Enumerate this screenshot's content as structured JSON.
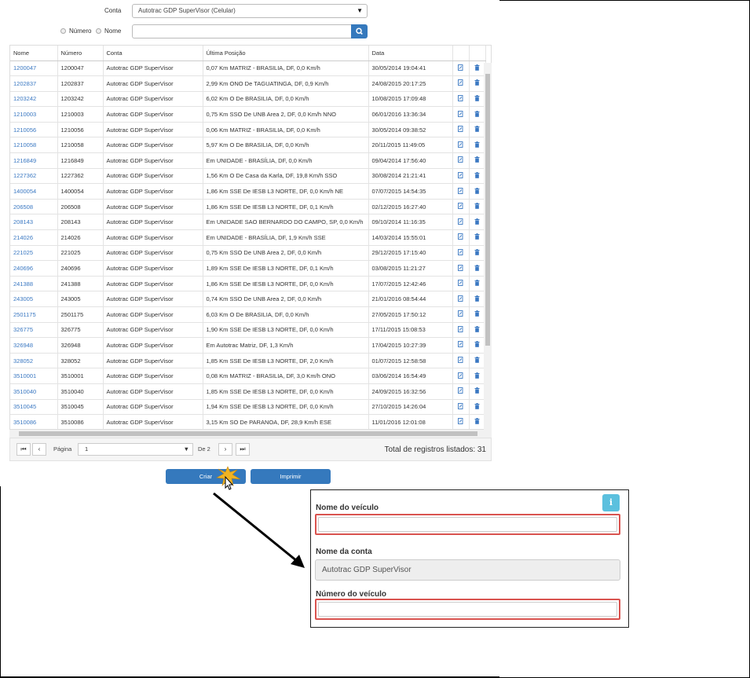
{
  "filters": {
    "account_label": "Conta",
    "account_value": "Autotrac GDP SuperVisor (Celular)",
    "radio_numero": "Número",
    "radio_nome": "Nome",
    "search_value": ""
  },
  "table": {
    "headers": [
      "Nome",
      "Número",
      "Conta",
      "Última Posição",
      "Data"
    ],
    "rows": [
      [
        "1200047",
        "1200047",
        "Autotrac GDP SuperVisor",
        "0,07 Km MATRIZ - BRASILIA, DF, 0,0 Km/h",
        "30/05/2014 19:04:41"
      ],
      [
        "1202837",
        "1202837",
        "Autotrac GDP SuperVisor",
        "2,99 Km ONO De TAGUATINGA, DF, 0,9 Km/h",
        "24/08/2015 20:17:25"
      ],
      [
        "1203242",
        "1203242",
        "Autotrac GDP SuperVisor",
        "6,02 Km O De BRASILIA, DF, 0,0 Km/h",
        "10/08/2015 17:09:48"
      ],
      [
        "1210003",
        "1210003",
        "Autotrac GDP SuperVisor",
        "0,75 Km SSO De UNB Area 2, DF, 0,0 Km/h NNO",
        "06/01/2016 13:36:34"
      ],
      [
        "1210056",
        "1210056",
        "Autotrac GDP SuperVisor",
        "0,06 Km MATRIZ - BRASILIA, DF, 0,0 Km/h",
        "30/05/2014 09:38:52"
      ],
      [
        "1210058",
        "1210058",
        "Autotrac GDP SuperVisor",
        "5,97 Km O De BRASILIA, DF, 0,0 Km/h",
        "20/11/2015 11:49:05"
      ],
      [
        "1216849",
        "1216849",
        "Autotrac GDP SuperVisor",
        "Em UNIDADE - BRASÍLIA, DF, 0,0 Km/h",
        "09/04/2014 17:56:40"
      ],
      [
        "1227362",
        "1227362",
        "Autotrac GDP SuperVisor",
        "1,56 Km O De Casa da Karla, DF, 19,8 Km/h SSO",
        "30/08/2014 21:21:41"
      ],
      [
        "1400054",
        "1400054",
        "Autotrac GDP SuperVisor",
        "1,86 Km SSE De IESB L3 NORTE, DF, 0,0 Km/h NE",
        "07/07/2015 14:54:35"
      ],
      [
        "206508",
        "206508",
        "Autotrac GDP SuperVisor",
        "1,86 Km SSE De IESB L3 NORTE, DF, 0,1 Km/h",
        "02/12/2015 16:27:40"
      ],
      [
        "208143",
        "208143",
        "Autotrac GDP SuperVisor",
        "Em UNIDADE SAO BERNARDO DO CAMPO, SP, 0,0 Km/h",
        "09/10/2014 11:16:35"
      ],
      [
        "214026",
        "214026",
        "Autotrac GDP SuperVisor",
        "Em UNIDADE - BRASÍLIA, DF, 1,9 Km/h SSE",
        "14/03/2014 15:55:01"
      ],
      [
        "221025",
        "221025",
        "Autotrac GDP SuperVisor",
        "0,75 Km SSO De UNB Area 2, DF, 0,0 Km/h",
        "29/12/2015 17:15:40"
      ],
      [
        "240696",
        "240696",
        "Autotrac GDP SuperVisor",
        "1,89 Km SSE De IESB L3 NORTE, DF, 0,1 Km/h",
        "03/08/2015 11:21:27"
      ],
      [
        "241388",
        "241388",
        "Autotrac GDP SuperVisor",
        "1,86 Km SSE De IESB L3 NORTE, DF, 0,0 Km/h",
        "17/07/2015 12:42:46"
      ],
      [
        "243005",
        "243005",
        "Autotrac GDP SuperVisor",
        "0,74 Km SSO De UNB Area 2, DF, 0,0 Km/h",
        "21/01/2016 08:54:44"
      ],
      [
        "2501175",
        "2501175",
        "Autotrac GDP SuperVisor",
        "6,03 Km O De BRASILIA, DF, 0,0 Km/h",
        "27/05/2015 17:50:12"
      ],
      [
        "326775",
        "326775",
        "Autotrac GDP SuperVisor",
        "1,90 Km SSE De IESB L3 NORTE, DF, 0,0 Km/h",
        "17/11/2015 15:08:53"
      ],
      [
        "326948",
        "326948",
        "Autotrac GDP SuperVisor",
        "Em Autotrac Matriz, DF, 1,3 Km/h",
        "17/04/2015 10:27:39"
      ],
      [
        "328052",
        "328052",
        "Autotrac GDP SuperVisor",
        "1,85 Km SSE De IESB L3 NORTE, DF, 2,0 Km/h",
        "01/07/2015 12:58:58"
      ],
      [
        "3510001",
        "3510001",
        "Autotrac GDP SuperVisor",
        "0,08 Km MATRIZ - BRASILIA, DF, 3,0 Km/h ONO",
        "03/06/2014 16:54:49"
      ],
      [
        "3510040",
        "3510040",
        "Autotrac GDP SuperVisor",
        "1,85 Km SSE De IESB L3 NORTE, DF, 0,0 Km/h",
        "24/09/2015 16:32:56"
      ],
      [
        "3510045",
        "3510045",
        "Autotrac GDP SuperVisor",
        "1,94 Km SSE De IESB L3 NORTE, DF, 0,0 Km/h",
        "27/10/2015 14:26:04"
      ],
      [
        "3510086",
        "3510086",
        "Autotrac GDP SuperVisor",
        "3,15 Km SO De PARANOA, DF, 28,9 Km/h ESE",
        "11/01/2016 12:01:08"
      ]
    ]
  },
  "pager": {
    "page_label": "Página",
    "page_value": "1",
    "of_label": "De 2",
    "total_label": "Total de registros listados: 31"
  },
  "actions": {
    "create_label": "Criar",
    "print_label": "Imprimir"
  },
  "form": {
    "vehicle_name_label": "Nome do veículo",
    "vehicle_name_value": "",
    "account_name_label": "Nome da conta",
    "account_name_value": "Autotrac GDP SuperVisor",
    "vehicle_number_label": "Número do veículo",
    "vehicle_number_value": "",
    "info_glyph": "i",
    "highlight_color": "#d9534f"
  },
  "colors": {
    "primary": "#3579bd",
    "link": "#3a78c2",
    "info": "#5bc0de"
  }
}
